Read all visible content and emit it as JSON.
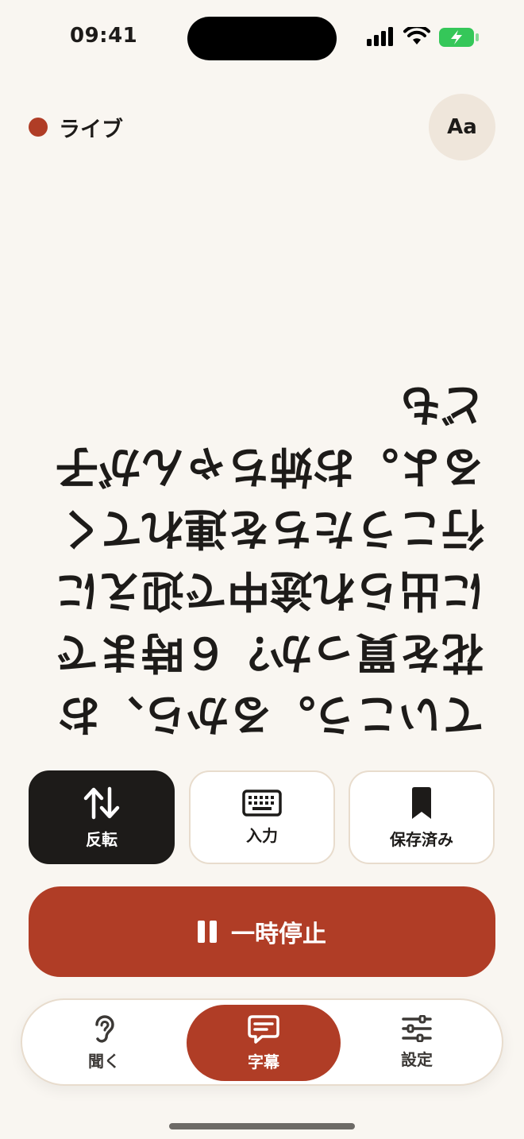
{
  "status_bar": {
    "time": "09:41",
    "icons": [
      "signal-icon",
      "wifi-icon",
      "battery-charging-icon"
    ],
    "battery_color": "#35c759"
  },
  "header": {
    "live_label": "ライブ",
    "font_button_label": "Aa"
  },
  "caption": {
    "text": "ていこう。るから、お花を買っか？６時までに出られ途中で迎えに行こうたちを連れてくるよ。お姉ちゃんが子ども",
    "orientation": "flipped"
  },
  "actions": {
    "flip_label": "反転",
    "input_label": "入力",
    "saved_label": "保存済み"
  },
  "pause_button": {
    "label": "一時停止"
  },
  "tab_bar": {
    "listen_label": "聞く",
    "captions_label": "字幕",
    "settings_label": "設定",
    "active": "captions"
  },
  "colors": {
    "accent": "#b03d26",
    "background": "#f9f6f1",
    "dark": "#1d1b19"
  }
}
